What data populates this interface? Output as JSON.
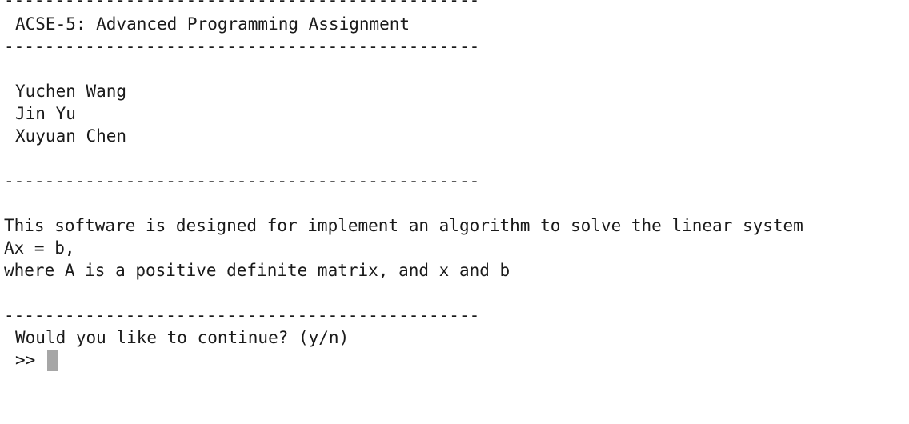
{
  "terminal": {
    "separator_top": "-----------------------------------------------",
    "title": "ACSE-5: Advanced Programming Assignment",
    "separator_after_title": "-----------------------------------------------",
    "authors": [
      "Yuchen Wang",
      "Jin Yu",
      "Xuyuan Chen"
    ],
    "separator_after_authors": "-----------------------------------------------",
    "description": [
      "This software is designed for implement an algorithm to solve the linear system",
      "Ax = b,",
      "where A is a positive definite matrix, and x and b"
    ],
    "separator_before_question": "-----------------------------------------------",
    "question": "Would you like to continue? (y/n)",
    "prompt": ">> "
  }
}
